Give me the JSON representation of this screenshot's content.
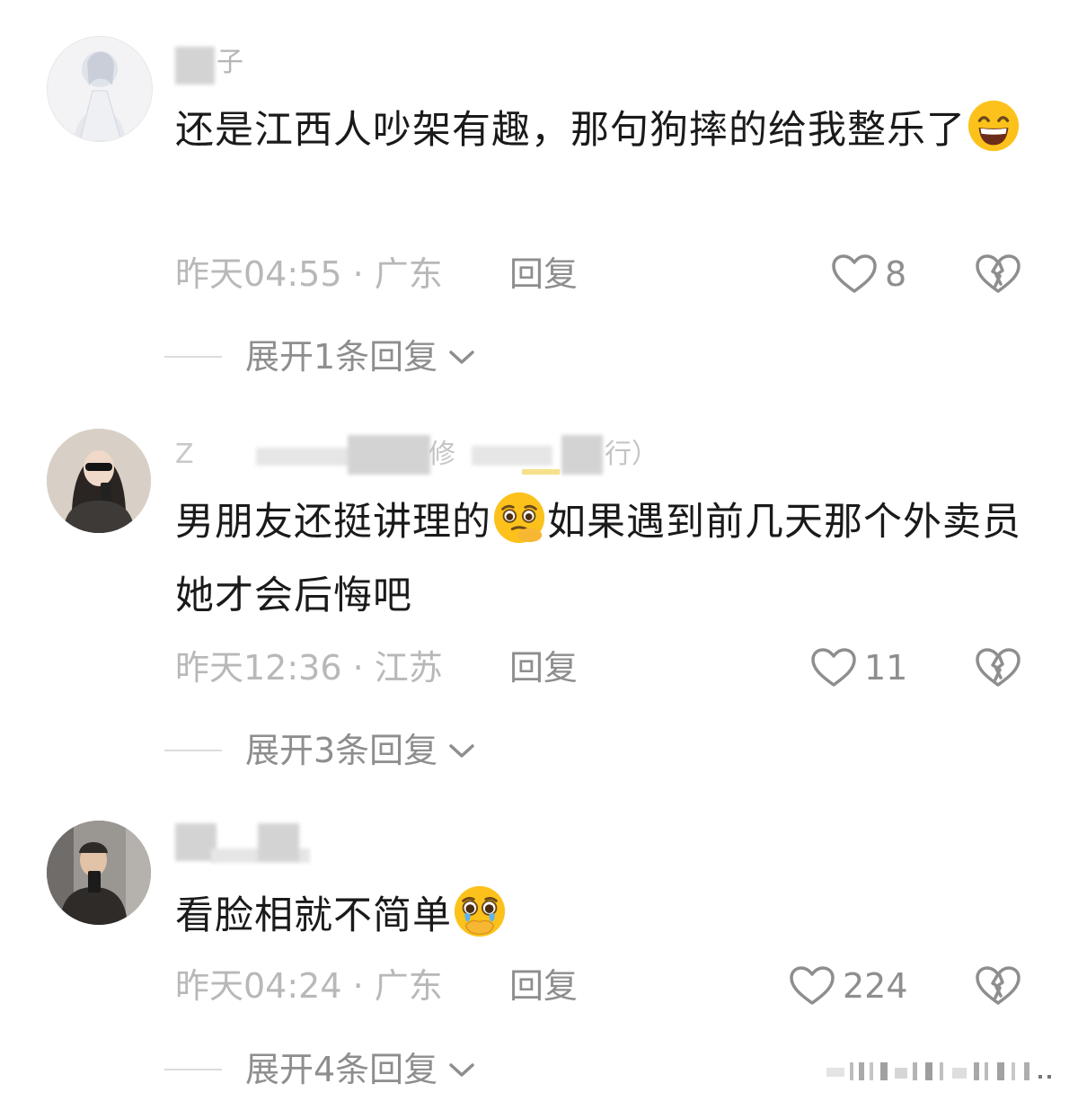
{
  "comments": [
    {
      "username_visible": "子",
      "text": "还是江西人吵架有趣，那句狗摔的给我整乐了",
      "emoji": "grinning-face",
      "time": "昨天04:55",
      "location": "广东",
      "reply_label": "回复",
      "likes": "8",
      "expand_label": "展开1条回复"
    },
    {
      "username_visible_start": "Z",
      "username_visible_mid": "修",
      "username_visible_end": "行）",
      "text_before_emoji": "男朋友还挺讲理的",
      "emoji": "pleading-face-hand",
      "text_after_emoji": "如果遇到前几天那个外卖员她才会后悔吧",
      "time": "昨天12:36",
      "location": "江苏",
      "reply_label": "回复",
      "likes": "11",
      "expand_label": "展开3条回复"
    },
    {
      "text": "看脸相就不简单",
      "emoji": "crying-covering-mouth-face",
      "time": "昨天04:24",
      "location": "广东",
      "reply_label": "回复",
      "likes": "224",
      "expand_label": "展开4条回复"
    }
  ],
  "colors": {
    "body_text": "#1a1a1a",
    "meta_text": "#b8b8b8",
    "action_text": "#8e8e8e",
    "emoji_yellow": "#fcc21b"
  },
  "separator": " · "
}
